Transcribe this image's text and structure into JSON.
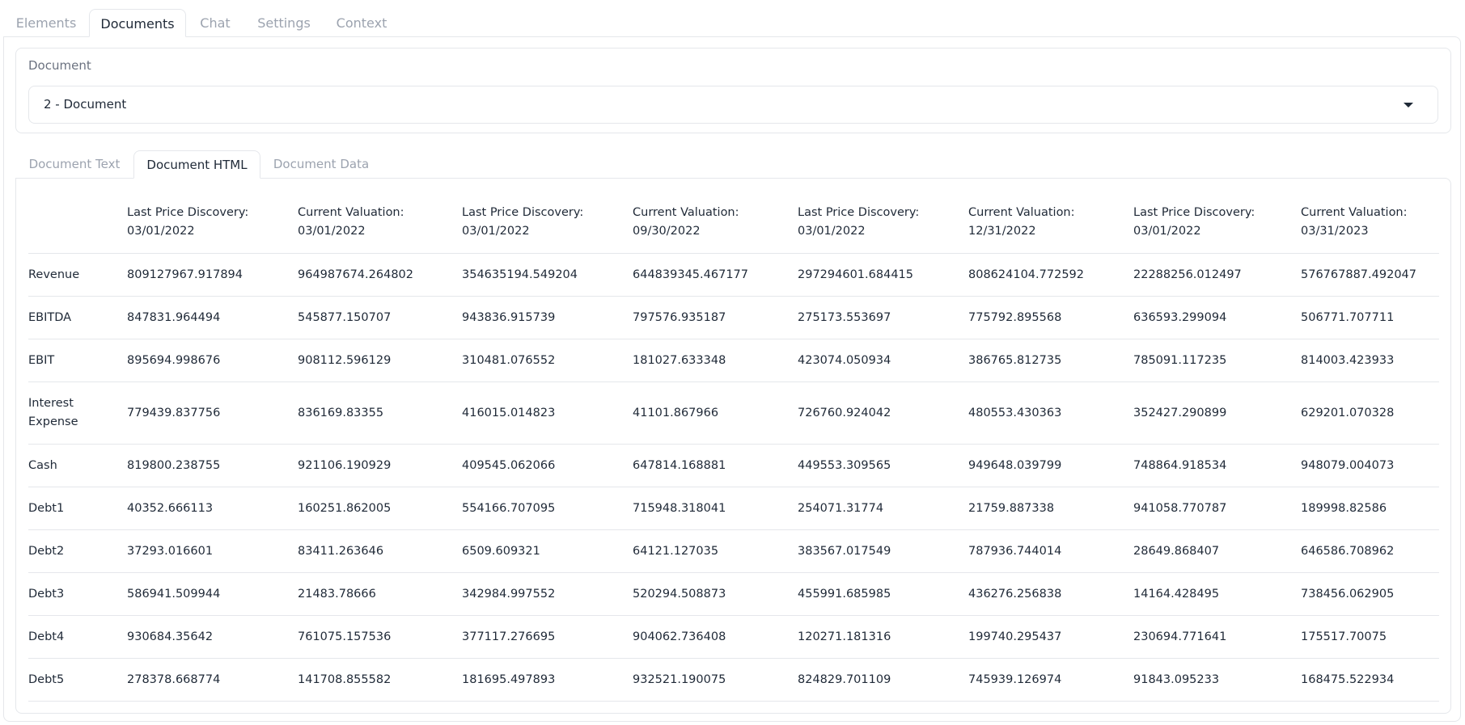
{
  "top_tabs": [
    "Elements",
    "Documents",
    "Chat",
    "Settings",
    "Context"
  ],
  "document": {
    "label": "Document",
    "selected": "2 - Document"
  },
  "inner_tabs": [
    "Document Text",
    "Document HTML",
    "Document Data"
  ],
  "table": {
    "headers": [
      [
        "Last Price Discovery:",
        "03/01/2022"
      ],
      [
        "Current Valuation:",
        "03/01/2022"
      ],
      [
        "Last Price Discovery:",
        "03/01/2022"
      ],
      [
        "Current Valuation:",
        "09/30/2022"
      ],
      [
        "Last Price Discovery:",
        "03/01/2022"
      ],
      [
        "Current Valuation:",
        "12/31/2022"
      ],
      [
        "Last Price Discovery:",
        "03/01/2022"
      ],
      [
        "Current Valuation:",
        "03/31/2023"
      ]
    ],
    "rows": [
      {
        "label": [
          "Revenue"
        ],
        "values": [
          "809127967.917894",
          "964987674.264802",
          "354635194.549204",
          "644839345.467177",
          "297294601.684415",
          "808624104.772592",
          "22288256.012497",
          "576767887.492047"
        ]
      },
      {
        "label": [
          "EBITDA"
        ],
        "values": [
          "847831.964494",
          "545877.150707",
          "943836.915739",
          "797576.935187",
          "275173.553697",
          "775792.895568",
          "636593.299094",
          "506771.707711"
        ]
      },
      {
        "label": [
          "EBIT"
        ],
        "values": [
          "895694.998676",
          "908112.596129",
          "310481.076552",
          "181027.633348",
          "423074.050934",
          "386765.812735",
          "785091.117235",
          "814003.423933"
        ]
      },
      {
        "label": [
          "Interest",
          "Expense"
        ],
        "values": [
          "779439.837756",
          "836169.83355",
          "416015.014823",
          "41101.867966",
          "726760.924042",
          "480553.430363",
          "352427.290899",
          "629201.070328"
        ]
      },
      {
        "label": [
          "Cash"
        ],
        "values": [
          "819800.238755",
          "921106.190929",
          "409545.062066",
          "647814.168881",
          "449553.309565",
          "949648.039799",
          "748864.918534",
          "948079.004073"
        ]
      },
      {
        "label": [
          "Debt1"
        ],
        "values": [
          "40352.666113",
          "160251.862005",
          "554166.707095",
          "715948.318041",
          "254071.31774",
          "21759.887338",
          "941058.770787",
          "189998.82586"
        ]
      },
      {
        "label": [
          "Debt2"
        ],
        "values": [
          "37293.016601",
          "83411.263646",
          "6509.609321",
          "64121.127035",
          "383567.017549",
          "787936.744014",
          "28649.868407",
          "646586.708962"
        ]
      },
      {
        "label": [
          "Debt3"
        ],
        "values": [
          "586941.509944",
          "21483.78666",
          "342984.997552",
          "520294.508873",
          "455991.685985",
          "436276.256838",
          "14164.428495",
          "738456.062905"
        ]
      },
      {
        "label": [
          "Debt4"
        ],
        "values": [
          "930684.35642",
          "761075.157536",
          "377117.276695",
          "904062.736408",
          "120271.181316",
          "199740.295437",
          "230694.771641",
          "175517.70075"
        ]
      },
      {
        "label": [
          "Debt5"
        ],
        "values": [
          "278378.668774",
          "141708.855582",
          "181695.497893",
          "932521.190075",
          "824829.701109",
          "745939.126974",
          "91843.095233",
          "168475.522934"
        ]
      }
    ]
  }
}
